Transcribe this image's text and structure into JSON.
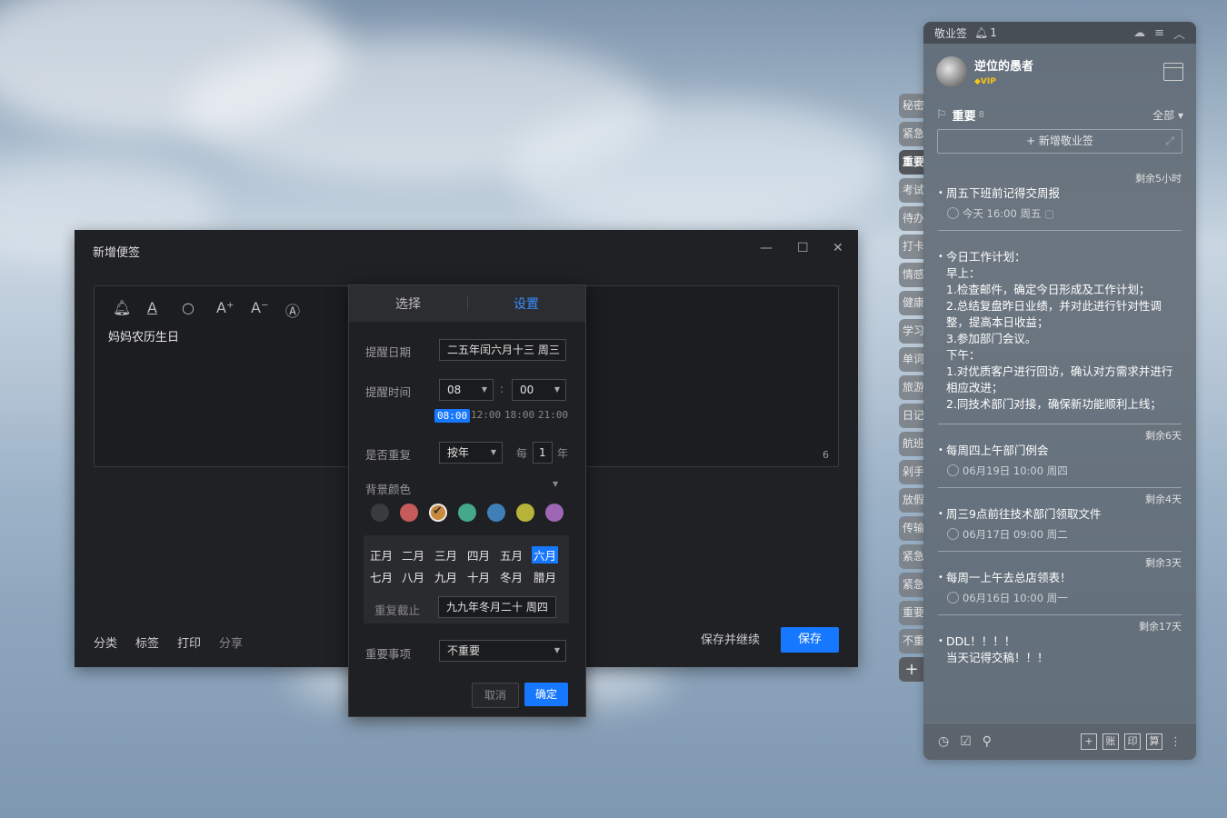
{
  "dialog": {
    "title": "新增便签",
    "controls": {
      "minimize": "—",
      "maximize": "☐",
      "close": "✕"
    },
    "toolbar_icons": [
      "bell-icon",
      "text-underline-icon",
      "search-icon",
      "font-increase-icon",
      "font-decrease-icon",
      "text-style-icon"
    ],
    "content": "妈妈农历生日",
    "char_count": "6",
    "bottom_links": [
      "分类",
      "标签",
      "打印",
      "分享"
    ],
    "save_continue": "保存并继续",
    "save": "保存"
  },
  "popup": {
    "tabs": [
      "选择",
      "设置"
    ],
    "remind_date_label": "提醒日期",
    "remind_date_value": "二五年闰六月十三  周三",
    "remind_time_label": "提醒时间",
    "hour": "08",
    "minute": "00",
    "colon": ":",
    "quick_times": [
      "08:00",
      "12:00",
      "18:00",
      "21:00"
    ],
    "repeat_label": "是否重复",
    "repeat_value": "按年",
    "every_label": "每",
    "every_value": "1",
    "every_unit": "年",
    "bg_color_label": "背景颜色",
    "colors": [
      "#3a3b3e",
      "#c65b5b",
      "#c98a3e",
      "#45a88a",
      "#3e7fb8",
      "#b7b33a",
      "#9d67b5"
    ],
    "selected_color_index": 2,
    "months_row1": [
      "正月",
      "二月",
      "三月",
      "四月",
      "五月",
      "六月"
    ],
    "months_row2": [
      "七月",
      "八月",
      "九月",
      "十月",
      "冬月",
      "腊月"
    ],
    "selected_month": "六月",
    "repeat_end_label": "重复截止",
    "repeat_end_value": "九九年冬月二十  周四",
    "importance_label": "重要事项",
    "importance_value": "不重要",
    "cancel": "取消",
    "confirm": "确定"
  },
  "side_tabs": [
    "秘密",
    "紧急",
    "重要",
    "考试",
    "待办",
    "打卡",
    "情感",
    "健康",
    "学习",
    "单词",
    "旅游",
    "日记",
    "航班",
    "剁手",
    "放假",
    "传输",
    "紧急",
    "紧急",
    "重要",
    "不重"
  ],
  "side_tab_add": "+",
  "panel": {
    "app_name": "敬业签",
    "notif_count": "1",
    "user_name": "逆位的愚者",
    "vip": "VIP",
    "category": "重要",
    "category_count": "8",
    "filter": "全部",
    "add_note": "+ 新增敬业签",
    "notes": [
      {
        "remain": "剩余5小时",
        "text": "周五下班前记得交周报",
        "meta": "今天 16:00 周五"
      },
      {
        "remain": "",
        "text": "今日工作计划：\n早上：\n1.检查邮件，确定今日形成及工作计划；\n2.总结复盘昨日业绩，并对此进行针对性调整，提高本日收益；\n3.参加部门会议。\n下午：\n1.对优质客户进行回访，确认对方需求并进行相应改进；\n2.同技术部门对接，确保新功能顺利上线；",
        "meta": ""
      },
      {
        "remain": "剩余6天",
        "text": "每周四上午部门例会",
        "meta": "06月19日 10:00 周四"
      },
      {
        "remain": "剩余4天",
        "text": "周三9点前往技术部门领取文件",
        "meta": "06月17日 09:00 周二"
      },
      {
        "remain": "剩余3天",
        "text": "每周一上午去总店领表！",
        "meta": "06月16日 10:00 周一"
      },
      {
        "remain": "剩余17天",
        "text": "DDL！！！！\n当天记得交稿！！！",
        "meta": ""
      }
    ],
    "footer_right": [
      "+",
      "账",
      "印",
      "算"
    ]
  }
}
